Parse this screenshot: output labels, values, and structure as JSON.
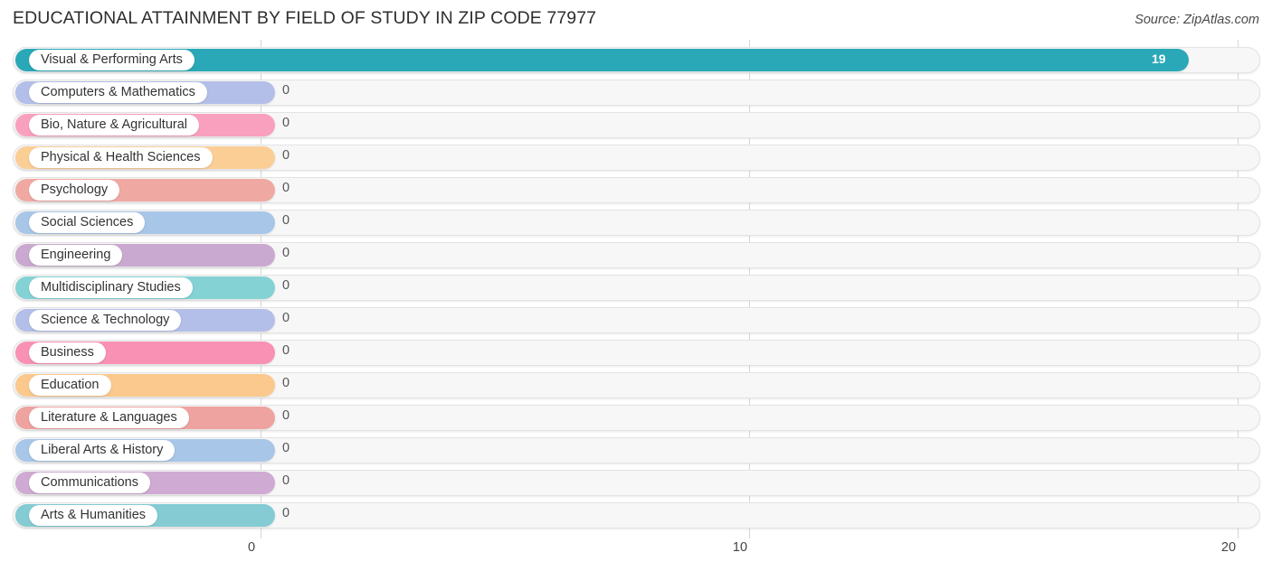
{
  "header": {
    "title": "EDUCATIONAL ATTAINMENT BY FIELD OF STUDY IN ZIP CODE 77977",
    "source": "Source: ZipAtlas.com"
  },
  "chart_data": {
    "type": "bar",
    "orientation": "horizontal",
    "title": "EDUCATIONAL ATTAINMENT BY FIELD OF STUDY IN ZIP CODE 77977",
    "xlabel": "",
    "ylabel": "",
    "xlim": [
      0,
      20
    ],
    "xticks": [
      "0",
      "10",
      "20"
    ],
    "xtick_values": [
      0,
      10,
      20
    ],
    "grid": true,
    "legend": "none",
    "categories": [
      "Visual & Performing Arts",
      "Computers & Mathematics",
      "Bio, Nature & Agricultural",
      "Physical & Health Sciences",
      "Psychology",
      "Social Sciences",
      "Engineering",
      "Multidisciplinary Studies",
      "Science & Technology",
      "Business",
      "Education",
      "Literature & Languages",
      "Liberal Arts & History",
      "Communications",
      "Arts & Humanities"
    ],
    "values": [
      19,
      0,
      0,
      0,
      0,
      0,
      0,
      0,
      0,
      0,
      0,
      0,
      0,
      0,
      0
    ],
    "value_labels": [
      "19",
      "0",
      "0",
      "0",
      "0",
      "0",
      "0",
      "0",
      "0",
      "0",
      "0",
      "0",
      "0",
      "0",
      "0"
    ],
    "colors": [
      "#2aa8b8",
      "#b3bfe8",
      "#f9a0bf",
      "#fbce96",
      "#f0a9a2",
      "#a8c6e8",
      "#c9a9cf",
      "#84d2d4",
      "#b3bfe8",
      "#f991b5",
      "#fbc98e",
      "#eea3a0",
      "#a8c6e8",
      "#cfaad3",
      "#84cbd3"
    ]
  },
  "axis": {
    "ticks": [
      {
        "label": "0"
      },
      {
        "label": "10"
      },
      {
        "label": "20"
      }
    ]
  }
}
